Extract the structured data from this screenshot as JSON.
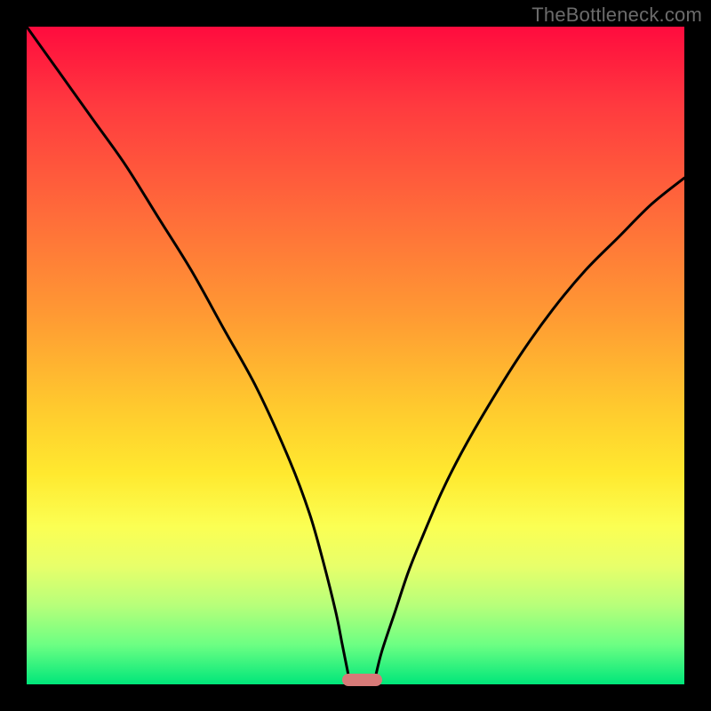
{
  "watermark": "TheBottleneck.com",
  "chart_data": {
    "type": "line",
    "title": "",
    "xlabel": "",
    "ylabel": "",
    "xlim": [
      0,
      100
    ],
    "ylim": [
      0,
      100
    ],
    "grid": false,
    "legend": false,
    "background_gradient": {
      "direction": "vertical",
      "stops": [
        {
          "pos": 0,
          "color": "#ff0b3e"
        },
        {
          "pos": 44,
          "color": "#ff9a33"
        },
        {
          "pos": 68,
          "color": "#ffe92f"
        },
        {
          "pos": 88,
          "color": "#b7ff7a"
        },
        {
          "pos": 100,
          "color": "#00e67a"
        }
      ]
    },
    "series": [
      {
        "name": "left-branch",
        "x": [
          0,
          5,
          10,
          15,
          20,
          25,
          30,
          35,
          40,
          43,
          45,
          47,
          48,
          49
        ],
        "values": [
          100,
          93,
          86,
          79,
          71,
          63,
          54,
          45,
          34,
          26,
          19,
          11,
          6,
          1
        ]
      },
      {
        "name": "right-branch",
        "x": [
          53,
          54,
          56,
          58,
          60,
          63,
          66,
          70,
          75,
          80,
          85,
          90,
          95,
          100
        ],
        "values": [
          1,
          5,
          11,
          17,
          22,
          29,
          35,
          42,
          50,
          57,
          63,
          68,
          73,
          77
        ]
      }
    ],
    "marker": {
      "name": "bottleneck-range",
      "x_start": 48,
      "x_end": 54,
      "y": 0,
      "color": "#d77a78"
    }
  }
}
